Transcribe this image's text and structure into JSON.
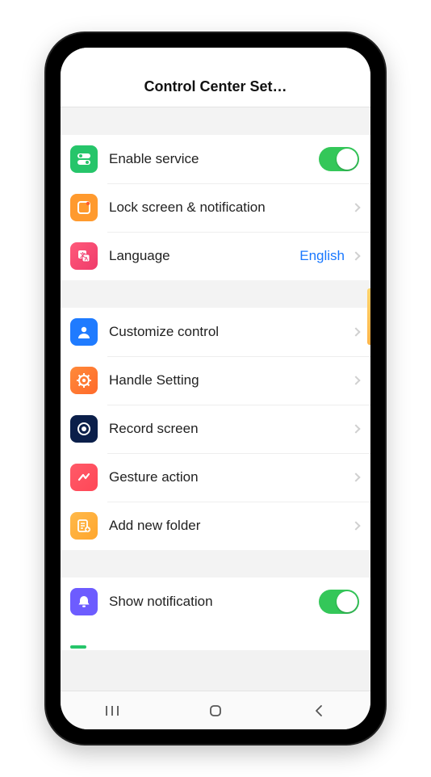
{
  "header": {
    "title": "Control Center Set…"
  },
  "group1": {
    "enable": {
      "label": "Enable service"
    },
    "lock": {
      "label": "Lock screen & notification"
    },
    "language": {
      "label": "Language",
      "value": "English"
    }
  },
  "group2": {
    "customize": {
      "label": "Customize control"
    },
    "handle": {
      "label": "Handle Setting"
    },
    "record": {
      "label": "Record screen"
    },
    "gesture": {
      "label": "Gesture action"
    },
    "folder": {
      "label": "Add new folder"
    }
  },
  "group3": {
    "notify": {
      "label": "Show notification"
    }
  },
  "colors": {
    "toggle_on": "#34c759",
    "accent_link": "#1978ff",
    "icon_green": "#26c56a",
    "icon_orange": "#ff9a2e",
    "icon_pink": "#ef3b6b",
    "icon_blue": "#1f7bff",
    "icon_deep_orange": "#ff6a2b",
    "icon_navy": "#0b1f4a",
    "icon_red": "#ff4757",
    "icon_amber": "#ffa62e",
    "icon_purple": "#6d5cff"
  }
}
